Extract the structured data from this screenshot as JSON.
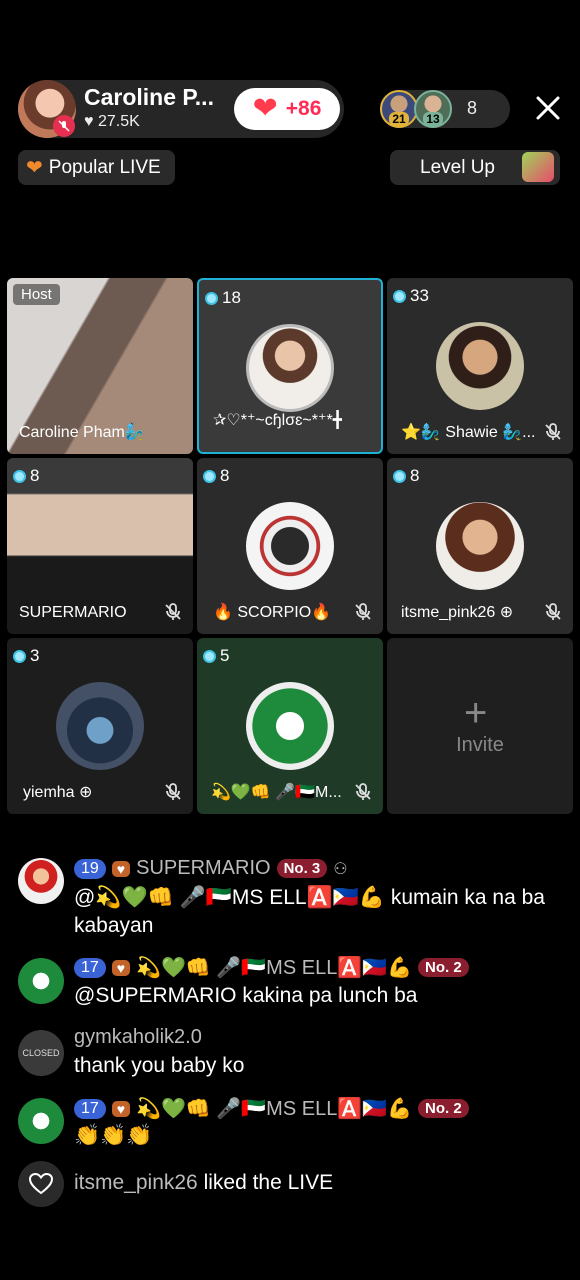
{
  "header": {
    "host_name": "Caroline P...",
    "host_likes": "27.5K",
    "follow_count": "+86",
    "viewer_badges": [
      "21",
      "13"
    ],
    "viewer_count": "8"
  },
  "pills": {
    "popular": "Popular LIVE",
    "levelup": "Level Up"
  },
  "grid": {
    "host_tag": "Host",
    "invite_label": "Invite",
    "cells": [
      {
        "name": "Caroline Pham🧞‍♂️",
        "viewers": ""
      },
      {
        "name": "✰♡*⁺~cɧlσɛ~*⁺*╋",
        "viewers": "18"
      },
      {
        "name": "⭐🧞‍♂️ Shawie 🧞‍♂️...",
        "viewers": "33"
      },
      {
        "name": "SUPERMARIO",
        "viewers": "8"
      },
      {
        "name": "🔥 SCORPIO🔥",
        "viewers": "8"
      },
      {
        "name": "itsme_pink26 ⊕",
        "viewers": "8"
      },
      {
        "name": "yiemha ⊕",
        "viewers": "3"
      },
      {
        "name": "💫💚👊 🎤🇦🇪M...",
        "viewers": "5"
      }
    ]
  },
  "comments": [
    {
      "level": "19",
      "user": "SUPERMARIO",
      "rank": "No. 3",
      "text": "@💫💚👊 🎤🇦🇪MS ELL🅰️🇵🇭💪 kumain  ka na ba kabayan"
    },
    {
      "level": "17",
      "user": "💫💚👊 🎤🇦🇪MS ELL🅰️🇵🇭💪",
      "rank": "No. 2",
      "text": "@SUPERMARIO kakina pa lunch ba"
    },
    {
      "user": "gymkaholik2.0",
      "text": "thank you baby ko"
    },
    {
      "level": "17",
      "user": "💫💚👊 🎤🇦🇪MS ELL🅰️🇵🇭💪",
      "rank": "No. 2",
      "text": "👏👏👏"
    }
  ],
  "liked": {
    "user": "itsme_pink26",
    "text": "liked the LIVE"
  }
}
